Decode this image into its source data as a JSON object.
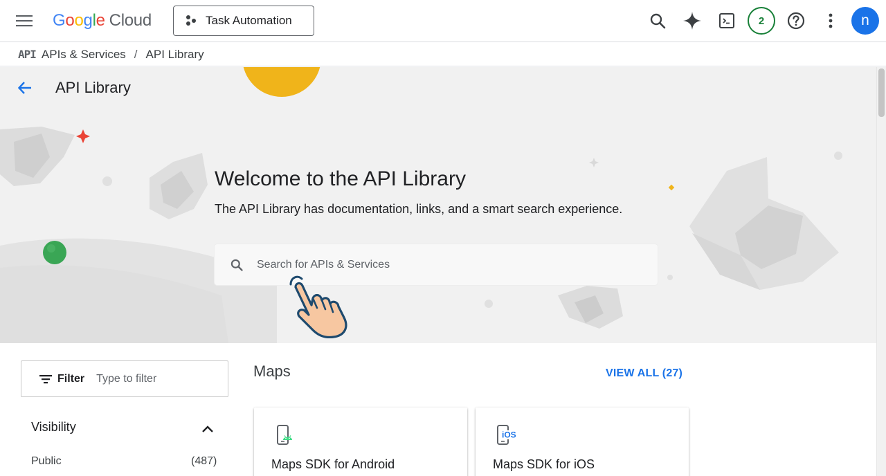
{
  "app": {
    "logo_letters": [
      "G",
      "o",
      "o",
      "g",
      "l",
      "e"
    ],
    "logo_suffix": "Cloud",
    "project": "Task Automation",
    "notification_count": "2",
    "avatar_initial": "n"
  },
  "breadcrumb": {
    "icon_text": "API",
    "items": [
      "APIs & Services",
      "API Library"
    ],
    "separator": "/"
  },
  "page": {
    "title": "API Library"
  },
  "hero": {
    "title": "Welcome to the API Library",
    "subtitle": "The API Library has documentation, links, and a smart search experience.",
    "search_placeholder": "Search for APIs & Services"
  },
  "sidebar": {
    "filter_label": "Filter",
    "filter_placeholder": "Type to filter",
    "visibility_title": "Visibility",
    "options": [
      {
        "label": "Public",
        "count": "(487)"
      }
    ]
  },
  "section": {
    "title": "Maps",
    "view_all": "VIEW ALL (27)",
    "cards": [
      {
        "title": "Maps SDK for Android",
        "icon": "android-phone-icon"
      },
      {
        "title": "Maps SDK for iOS",
        "icon": "ios-phone-icon",
        "icon_text": "iOS"
      }
    ]
  },
  "colors": {
    "primary": "#1a73e8",
    "badge_green": "#188038",
    "hero_bg": "#f1f1f1"
  }
}
